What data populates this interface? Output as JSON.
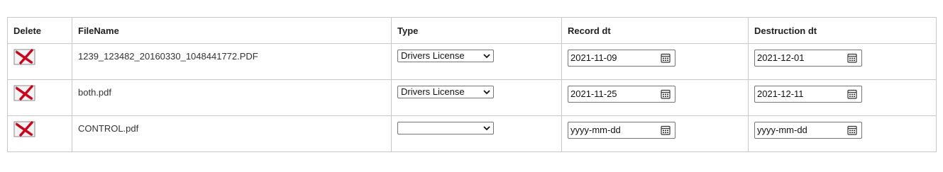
{
  "headers": {
    "delete": "Delete",
    "filename": "FileName",
    "type": "Type",
    "record_dt": "Record dt",
    "destruction_dt": "Destruction dt"
  },
  "rows": [
    {
      "filename": "1239_123482_20160330_1048441772.PDF",
      "type": "Drivers License",
      "record_dt": "2021-11-09",
      "destruction_dt": "2021-12-01"
    },
    {
      "filename": "both.pdf",
      "type": "Drivers License",
      "record_dt": "2021-11-25",
      "destruction_dt": "2021-12-11"
    },
    {
      "filename": "CONTROL.pdf",
      "type": "",
      "record_dt": "yyyy-mm-dd",
      "destruction_dt": "yyyy-mm-dd"
    }
  ],
  "icons": {
    "delete": "delete-x-icon",
    "dropdown": "chevron-down-icon",
    "calendar": "calendar-icon"
  },
  "colors": {
    "delete_x": "#d0021b",
    "border": "#c8c8c8"
  }
}
